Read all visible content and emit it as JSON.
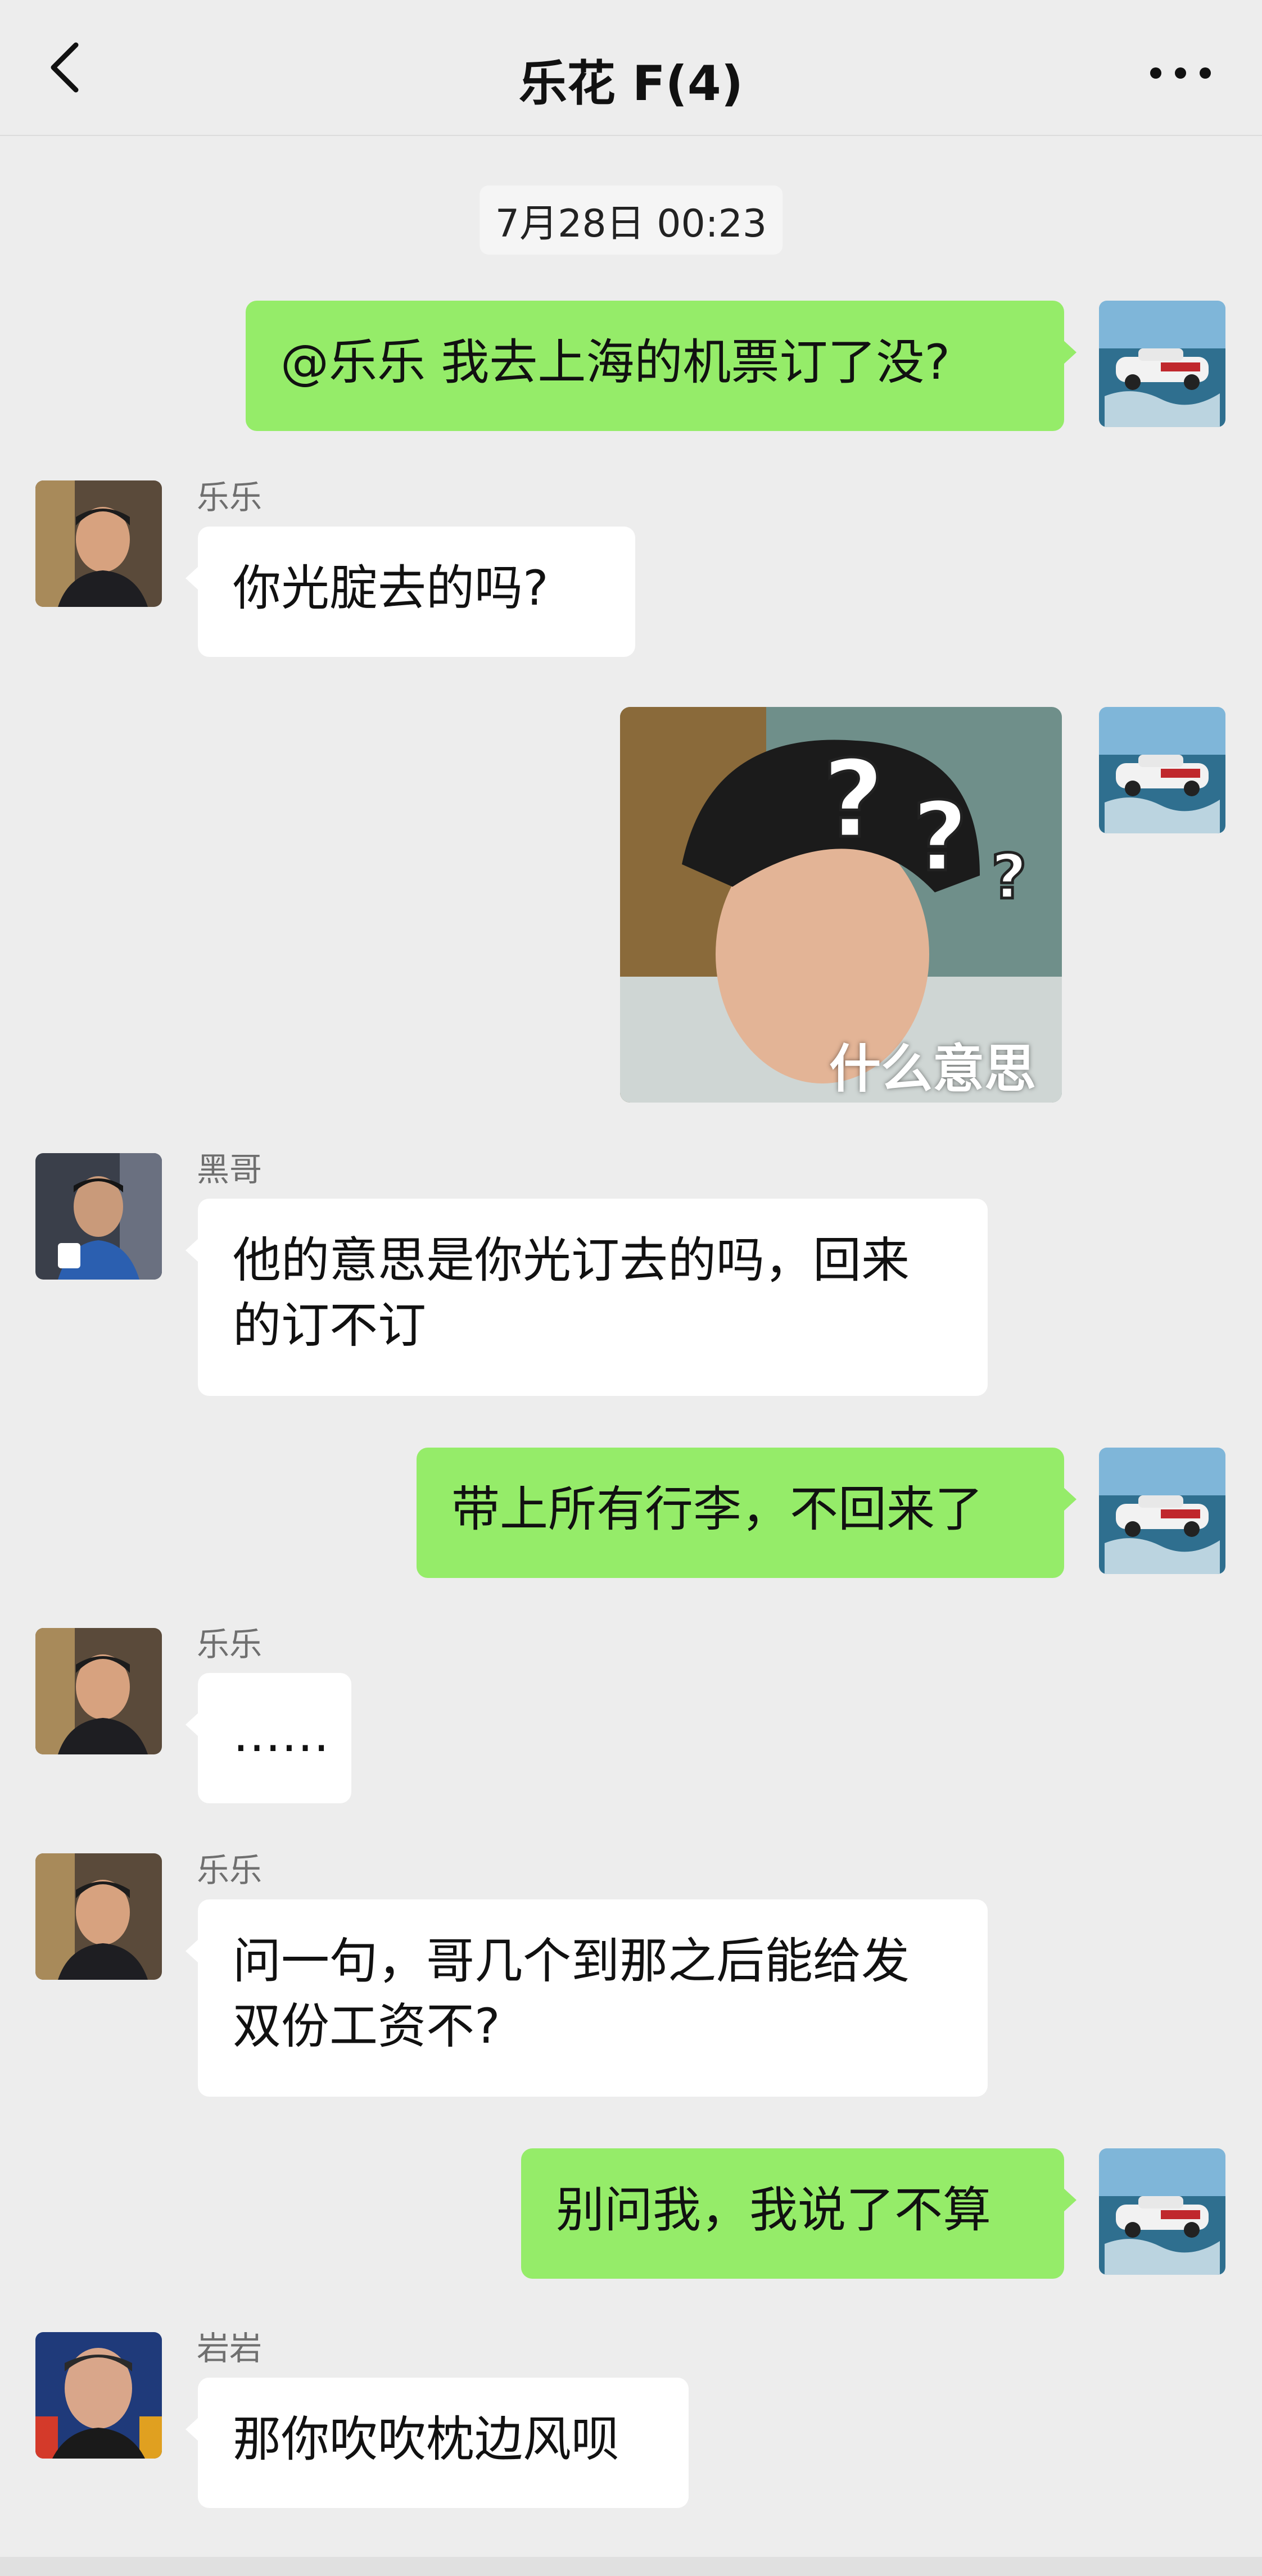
{
  "header": {
    "title": "乐花 F(4)",
    "back_icon": "chevron-left-icon",
    "more_icon": "ellipsis-icon"
  },
  "timestamp": "7月28日 00:23",
  "messages": [
    {
      "side": "sent",
      "text": "@乐乐 我去上海的机票订了没?"
    },
    {
      "side": "recv",
      "sender": "乐乐",
      "text": "你光腚去的吗?"
    },
    {
      "side": "sent",
      "type": "sticker",
      "caption": "什么意思"
    },
    {
      "side": "recv",
      "sender": "黑哥",
      "lines": [
        "他的意思是你光订去的吗，回来",
        "的订不订"
      ]
    },
    {
      "side": "sent",
      "text": "带上所有行李，不回来了"
    },
    {
      "side": "recv",
      "sender": "乐乐",
      "text": "……"
    },
    {
      "side": "recv",
      "sender": "乐乐",
      "lines": [
        "问一句，哥几个到那之后能给发",
        "双份工资不?"
      ]
    },
    {
      "side": "sent",
      "text": "别问我，我说了不算"
    },
    {
      "side": "recv",
      "sender": "岩岩",
      "text": "那你吹吹枕边风呗"
    }
  ],
  "colors": {
    "background": "#ededed",
    "sent_bubble": "#95ec69",
    "recv_bubble": "#ffffff"
  }
}
